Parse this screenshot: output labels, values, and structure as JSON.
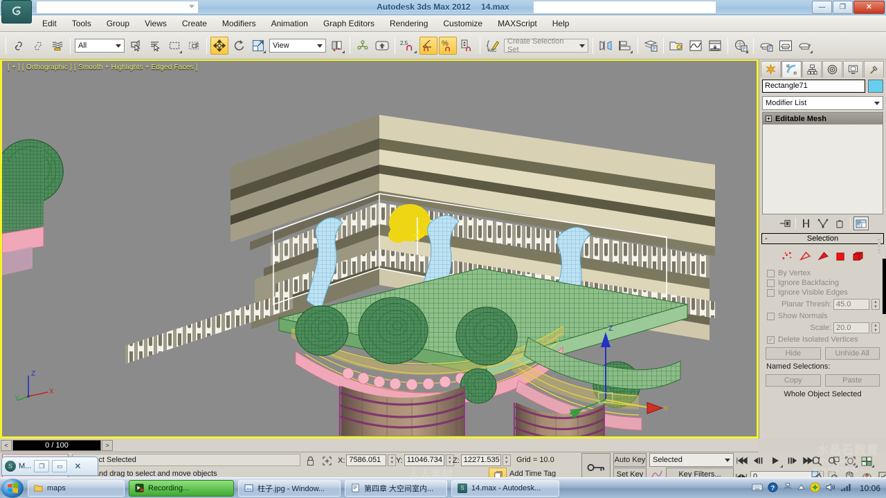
{
  "titlebar": {
    "app_title": "Autodesk 3ds Max  2012",
    "file_name": "14.max",
    "minimize": "—",
    "maximize": "❐",
    "close": "✕"
  },
  "menu": {
    "items": [
      "Edit",
      "Tools",
      "Group",
      "Views",
      "Create",
      "Modifiers",
      "Animation",
      "Graph Editors",
      "Rendering",
      "Customize",
      "MAXScript",
      "Help"
    ]
  },
  "toolbar": {
    "selection_filter": "All",
    "reference_coord": "View",
    "named_selection_set": "Create Selection Set",
    "angle_snap_value": "2.5",
    "buttons": [
      {
        "name": "select-link-button",
        "glyph": "🔗"
      },
      {
        "name": "unlink-selection-button",
        "glyph": "🔗"
      },
      {
        "name": "bind-to-space-warp-button",
        "glyph": "≈"
      },
      {
        "name": "select-object-button",
        "glyph": "▱"
      },
      {
        "name": "select-by-name-button",
        "glyph": "≣"
      },
      {
        "name": "rectangular-selection-region-button",
        "glyph": "▭"
      },
      {
        "name": "window-crossing-toggle-button",
        "glyph": "⬚"
      },
      {
        "name": "select-and-move-button",
        "glyph": "✥"
      },
      {
        "name": "select-and-rotate-button",
        "glyph": "↻"
      },
      {
        "name": "select-and-scale-button",
        "glyph": "⤢"
      },
      {
        "name": "use-center-flyout-button",
        "glyph": "▣"
      },
      {
        "name": "select-and-manipulate-button",
        "glyph": "⚯"
      },
      {
        "name": "keyboard-shortcut-override-button",
        "glyph": "⬆"
      },
      {
        "name": "snaps-toggle-button",
        "glyph": "2.5"
      },
      {
        "name": "angle-snap-toggle-button",
        "glyph": "∠"
      },
      {
        "name": "percent-snap-toggle-button",
        "glyph": "%"
      },
      {
        "name": "spinner-snap-toggle-button",
        "glyph": "⇕"
      },
      {
        "name": "edit-named-selection-sets-button",
        "glyph": "✎"
      },
      {
        "name": "mirror-button",
        "glyph": "◪"
      },
      {
        "name": "align-flyout-button",
        "glyph": "▤"
      },
      {
        "name": "layer-manager-button",
        "glyph": "▤"
      },
      {
        "name": "graphite-modeling-tools-button",
        "glyph": "🗀"
      },
      {
        "name": "curve-editor-button",
        "glyph": "📈"
      },
      {
        "name": "schematic-view-button",
        "glyph": "⊟"
      },
      {
        "name": "material-editor-button",
        "glyph": "◍"
      },
      {
        "name": "render-setup-button",
        "glyph": "🫖"
      },
      {
        "name": "rendered-frame-window-button",
        "glyph": "🫖"
      },
      {
        "name": "render-production-button",
        "glyph": "🫖"
      }
    ]
  },
  "viewport": {
    "label": "[ + ] [ Orthographic ] [ Smooth + Highlights + Edged Faces ]",
    "axis_labels": {
      "x": "X",
      "y": "Y",
      "z": "Z"
    },
    "gizmo_labels": {
      "x": "X",
      "z": "Z"
    }
  },
  "command_panel": {
    "tabs": [
      {
        "name": "tab-create",
        "icon": "star-icon",
        "active": false
      },
      {
        "name": "tab-modify",
        "icon": "curve-icon",
        "active": true
      },
      {
        "name": "tab-hierarchy",
        "icon": "hierarchy-icon",
        "active": false
      },
      {
        "name": "tab-motion",
        "icon": "target-icon",
        "active": false
      },
      {
        "name": "tab-display",
        "icon": "monitor-icon",
        "active": false
      },
      {
        "name": "tab-utilities",
        "icon": "hammer-icon",
        "active": false
      }
    ],
    "object_name": "Rectangle71",
    "object_color": "#64d0ee",
    "modifier_list_label": "Modifier List",
    "stack_items": [
      "Editable Mesh"
    ],
    "stack_buttons": [
      {
        "name": "pin-stack-button",
        "glyph": "⊣⊏"
      },
      {
        "name": "show-end-result-button",
        "glyph": "⫿⫾"
      },
      {
        "name": "make-unique-button",
        "glyph": "⋎"
      },
      {
        "name": "remove-modifier-button",
        "glyph": "🗑"
      },
      {
        "name": "configure-modifier-sets-button",
        "glyph": "▤"
      }
    ],
    "selection_rollout": {
      "title": "Selection",
      "collapse_glyph": "-",
      "sub_object_icons": [
        {
          "name": "vertex-sub-object-icon",
          "glyph": "⁘"
        },
        {
          "name": "edge-sub-object-icon",
          "glyph": "◁"
        },
        {
          "name": "face-sub-object-icon",
          "glyph": "◀"
        },
        {
          "name": "polygon-sub-object-icon",
          "glyph": "■"
        },
        {
          "name": "element-sub-object-icon",
          "glyph": "⬛"
        }
      ],
      "checkboxes": [
        {
          "label": "By Vertex",
          "checked": false
        },
        {
          "label": "Ignore Backfacing",
          "checked": false
        },
        {
          "label": "Ignore Visible Edges",
          "checked": false
        }
      ],
      "planar_thresh_label": "Planar Thresh:",
      "planar_thresh_value": "45.0",
      "show_normals_label": "Show Normals",
      "show_normals_checked": false,
      "scale_label": "Scale:",
      "scale_value": "20.0",
      "delete_isolated_label": "Delete Isolated Vertices",
      "delete_isolated_checked": true,
      "hide_button": "Hide",
      "unhide_all_button": "Unhide All",
      "named_selections_label": "Named Selections:",
      "copy_button": "Copy",
      "paste_button": "Paste",
      "status_text": "Whole Object Selected"
    }
  },
  "trackbar": {
    "prev_key": "<",
    "next_key": ">",
    "current_frame": "0 / 100"
  },
  "statusbar": {
    "objects_selected": "1 Object Selected",
    "prompt": "Click and drag to select and move objects",
    "lock_icon": "lock-icon",
    "coordinate_toggle_icon": "absolute-relative-icon",
    "x_label": "X:",
    "x_value": "7586.051",
    "y_label": "Y:",
    "y_value": "11046.734",
    "z_label": "Z:",
    "z_value": "12271.535",
    "grid_text": "Grid = 10.0",
    "add_time_tag": "Add Time Tag",
    "key_mode_icon": "key-icon"
  },
  "animation": {
    "auto_key": "Auto Key",
    "set_key": "Set Key",
    "selection_level": "Selected",
    "key_filters": "Key Filters...",
    "current_frame_field": "0",
    "transport": [
      {
        "name": "go-to-start-button",
        "glyph": "⏮"
      },
      {
        "name": "previous-frame-button",
        "glyph": "◀⏸"
      },
      {
        "name": "play-animation-button",
        "glyph": "▶"
      },
      {
        "name": "next-frame-button",
        "glyph": "⏸▶"
      },
      {
        "name": "go-to-end-button",
        "glyph": "⏭"
      }
    ],
    "key_mode_toggle": "⏮⏭"
  },
  "viewport_nav": {
    "buttons": [
      {
        "name": "zoom-button",
        "glyph": "🔍"
      },
      {
        "name": "zoom-all-button",
        "glyph": "🔎"
      },
      {
        "name": "zoom-extents-button",
        "glyph": "⛶"
      },
      {
        "name": "zoom-extents-all-button",
        "glyph": "▦"
      },
      {
        "name": "field-of-view-button",
        "glyph": "🔍"
      },
      {
        "name": "zoom-region-button",
        "glyph": "⬚"
      },
      {
        "name": "pan-view-button",
        "glyph": "✋"
      },
      {
        "name": "orbit-button",
        "glyph": "⟳"
      },
      {
        "name": "maximize-viewport-toggle-button",
        "glyph": "⤢"
      }
    ]
  },
  "floating_window": {
    "title": "M...",
    "restore": "❐",
    "minimize": "▭",
    "close": "✕"
  },
  "taskbar": {
    "start": "start-orb",
    "tasks": [
      {
        "name": "taskbar-item-maps",
        "label": "maps",
        "icon": "folder-icon",
        "state": "normal"
      },
      {
        "name": "taskbar-item-recording",
        "label": "Recording...",
        "icon": "recorder-icon",
        "state": "active"
      },
      {
        "name": "taskbar-item-image",
        "label": "柱子.jpg - Window...",
        "icon": "photo-icon",
        "state": "normal"
      },
      {
        "name": "taskbar-item-document",
        "label": "第四章 大空间室内...",
        "icon": "doc-icon",
        "state": "normal"
      },
      {
        "name": "taskbar-item-max",
        "label": "14.max - Autodesk...",
        "icon": "max-icon",
        "state": "normal"
      }
    ],
    "tray": [
      {
        "name": "keyboard-tray-icon",
        "glyph": "⌨"
      },
      {
        "name": "help-tray-icon",
        "glyph": "?"
      },
      {
        "name": "network-tray-icon",
        "glyph": "🖧"
      },
      {
        "name": "show-hidden-icons-button",
        "glyph": "▲"
      },
      {
        "name": "antivirus-tray-icon",
        "glyph": "✦"
      },
      {
        "name": "volume-tray-icon",
        "glyph": "🔊"
      },
      {
        "name": "signal-tray-icon",
        "glyph": "▁▃▅▇"
      }
    ],
    "clock": "10:06"
  },
  "watermarks": {
    "right_top": "水晶石教育",
    "right_mid": "CRYSTAL EDUCATION",
    "center": "人人素材",
    "colors": {
      "accent_yellow": "#f7f32a",
      "viewport_bg": "#8b8b8b"
    }
  }
}
